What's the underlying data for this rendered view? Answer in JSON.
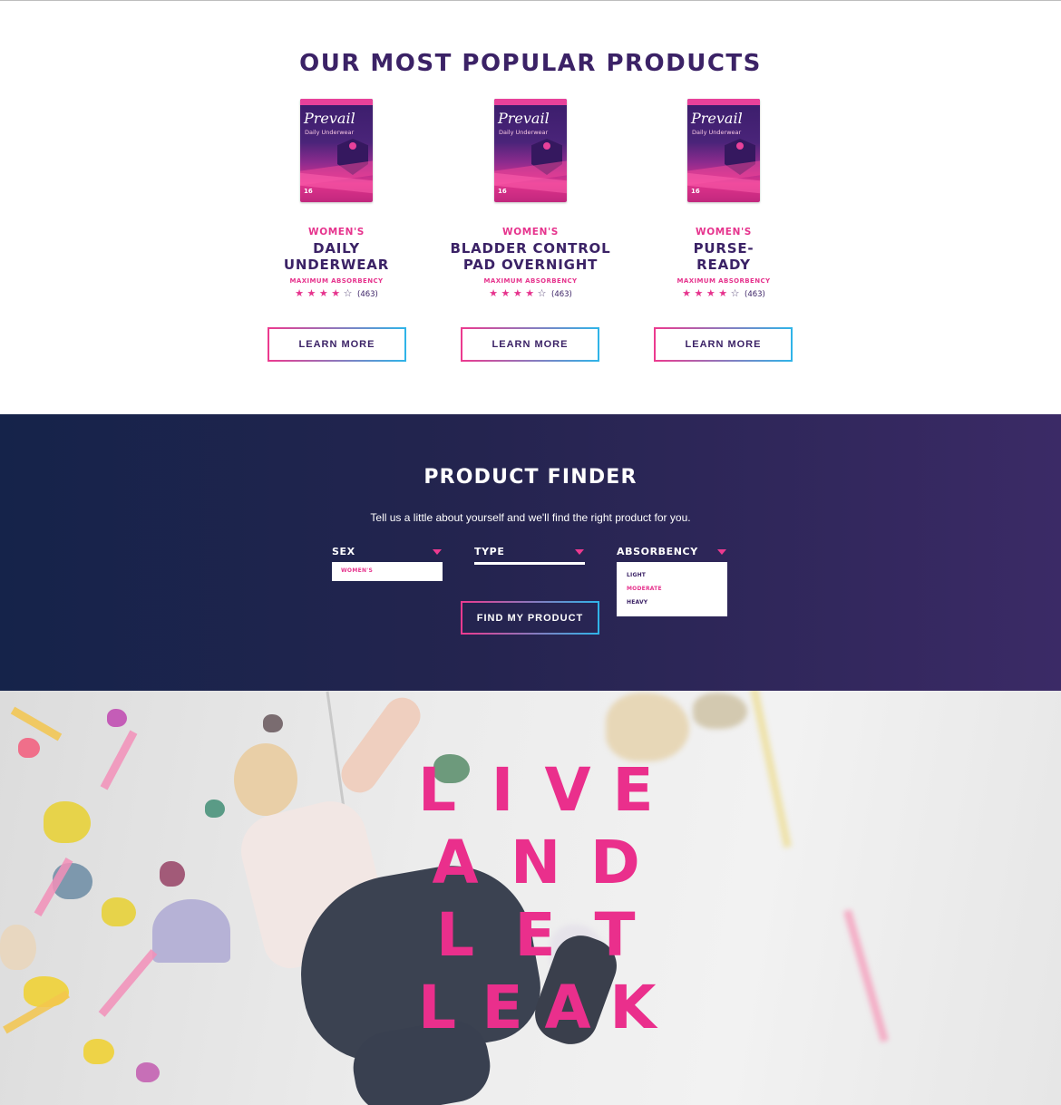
{
  "popular": {
    "title": "OUR MOST POPULAR PRODUCTS",
    "products": [
      {
        "eyebrow": "WOMEN'S",
        "title_line1": "DAILY",
        "title_line2": "UNDERWEAR",
        "absorbency": "MAXIMUM ABSORBENCY",
        "rating": 4,
        "review_count": "(463)",
        "cta": "LEARN MORE",
        "pack": {
          "brand": "Prevail",
          "subtitle": "Daily Underwear",
          "count": "16"
        }
      },
      {
        "eyebrow": "WOMEN'S",
        "title_line1": "BLADDER CONTROL",
        "title_line2": "PAD OVERNIGHT",
        "absorbency": "MAXIMUM ABSORBENCY",
        "rating": 4,
        "review_count": "(463)",
        "cta": "LEARN MORE",
        "pack": {
          "brand": "Prevail",
          "subtitle": "Daily Underwear",
          "count": "16"
        }
      },
      {
        "eyebrow": "WOMEN'S",
        "title_line1": "PURSE-",
        "title_line2": "READY",
        "absorbency": "MAXIMUM ABSORBENCY",
        "rating": 4,
        "review_count": "(463)",
        "cta": "LEARN MORE",
        "pack": {
          "brand": "Prevail",
          "subtitle": "Daily Underwear",
          "count": "16"
        }
      }
    ]
  },
  "finder": {
    "title": "PRODUCT FINDER",
    "subtitle": "Tell us a little about yourself and we'll find the right product for you.",
    "sex": {
      "label": "SEX",
      "selected": "WOMEN'S"
    },
    "type": {
      "label": "TYPE"
    },
    "absorbency": {
      "label": "ABSORBENCY",
      "options": [
        "LIGHT",
        "MODERATE",
        "HEAVY"
      ],
      "active_option": "MODERATE"
    },
    "cta": "FIND MY PRODUCT"
  },
  "hero": {
    "lines": [
      "LIVE",
      "AND",
      "LET",
      "LEAK"
    ]
  },
  "colors": {
    "brand_purple": "#3b2266",
    "brand_pink": "#e6338d",
    "accent_blue": "#2fb4e8",
    "finder_bg_left": "#15234a",
    "finder_bg_right": "#3b2a66"
  }
}
